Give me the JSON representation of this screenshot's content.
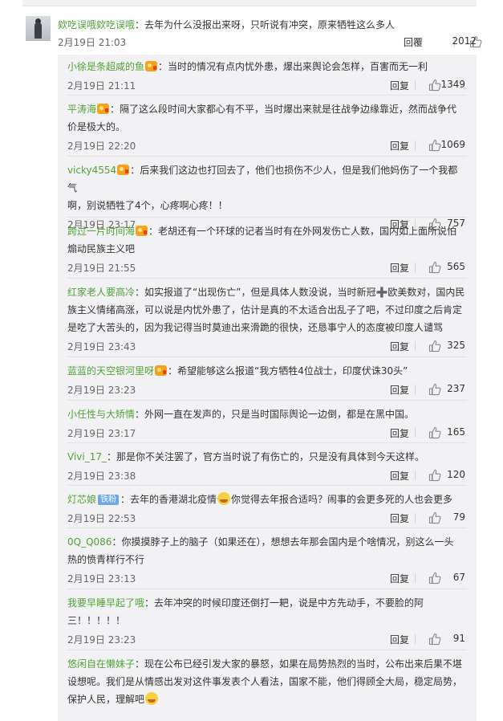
{
  "main_comment": {
    "user": "欸吃误哦欸吃误哦",
    "text": "：去年为什么没报出来呀，只听说有冲突，原来牺牲这么多人",
    "date": "2月19日 21:03",
    "reply_label": "回覆",
    "likes": "2012"
  },
  "replies": [
    {
      "user": "小徐是条超咸的鱼",
      "text": "：当时的情况有点内忧外患，爆出来舆论会怎样，百害而无一利",
      "date": "2月19日 21:11",
      "reply_label": "回复",
      "likes": "1349"
    },
    {
      "user": "平涛海",
      "text_line1": "：隔了这么段时间大家都心有不平，当时爆出来就是往战争边缘靠近，然而战争代",
      "text_line2": "价是极大的。",
      "date": "2月19日 22:20",
      "reply_label": "回复",
      "likes": "1069"
    },
    {
      "user": "vicky4554",
      "text_line1": "：后来我们这边也打回去了，他们也损伤不少人，但是我们他妈伤了一个我都气",
      "text_line2": "啊，别说牺牲了4个，心疼啊心疼！！",
      "date": "2月19日 23:17",
      "reply_label": "回复",
      "likes": "757"
    },
    {
      "user": "跨过一片时间海",
      "text_line1": "：老胡还有一个环球的记者当时有在外网发伤亡人数，国内如上面所说怕",
      "text_line2": "煽动民族主义吧",
      "date": "2月19日 21:55",
      "reply_label": "回复",
      "likes": "565"
    },
    {
      "user": "红家老人要高冷",
      "text_line1": "：如实报道了“出现伤亡”，但是具体人数没说，当时新冠➕欧美数对，国内民",
      "text_line2": "族主义情绪高涨，可以说是内忧外患了，估计是真的不太适合出乱子了吧，不过印度之后肯定",
      "text_line3": "是吃了大苦头的，因为我记得当时莫迪出来滑跪的很快，还恳事宁人的态度被印度人谴骂",
      "date": "2月19日 23:43",
      "reply_label": "回复",
      "likes": "325"
    },
    {
      "user": "蓝蓝的天空银河里呀",
      "text": "：希望能够这么报道“我方牺牲4位战士，印度伏诛30头”",
      "date": "2月19日 23:23",
      "reply_label": "回复",
      "likes": "237"
    },
    {
      "user": "小任性与大矫情",
      "text": "：外网一直在发声的，只是当时国际舆论一边倒，都是在黑中国。",
      "date": "2月19日 23:17",
      "reply_label": "回复",
      "likes": "165"
    },
    {
      "user": "Vivi_17_",
      "text": "：那是你不关注罢了，官方当时说了有伤亡的，只是没有具体到今天这样。",
      "date": "2月19日 23:38",
      "reply_label": "回复",
      "likes": "120"
    },
    {
      "user": "灯芯娘",
      "badge": "铁粉",
      "text_a": "：去年的香港湖北疫情",
      "text_b": "你觉得去年报合适吗？闹事的会更多死的人也会更多",
      "date": "2月19日 22:53",
      "reply_label": "回复",
      "likes": "79"
    },
    {
      "user": "0Q_Q086",
      "text_line1": "：你摸摸脖子上的脑子（如果还在），想想去年那会国内是个啥情况，别这么一头",
      "text_line2": "热的愤青样行不行",
      "date": "2月19日 23:13",
      "reply_label": "回复",
      "likes": "67"
    },
    {
      "user": "我要早睡早起了哦",
      "text_line1": "：去年冲突的时候印度还倒打一耙，说是中方先动手，不要脸的阿",
      "text_line2": "三！！！！！",
      "date": "2月19日 23:23",
      "reply_label": "回复",
      "likes": "91"
    },
    {
      "user": "悠闲自在懒妹子",
      "text_line1": "：现在公布已经引发大家的暴怒，如果在局势热烈的当时，公布出来后果不堪",
      "text_line2": "设想呢。我们是从情感出发对这件事发表个人看法，国家不能，他们得顾全大局，稳定局势，",
      "text_line3": "保护人民，理解吧"
    }
  ],
  "colors": {
    "username": "#51a336",
    "reply_bg": "#f2f2f5",
    "text": "#333333",
    "meta": "#666666"
  }
}
